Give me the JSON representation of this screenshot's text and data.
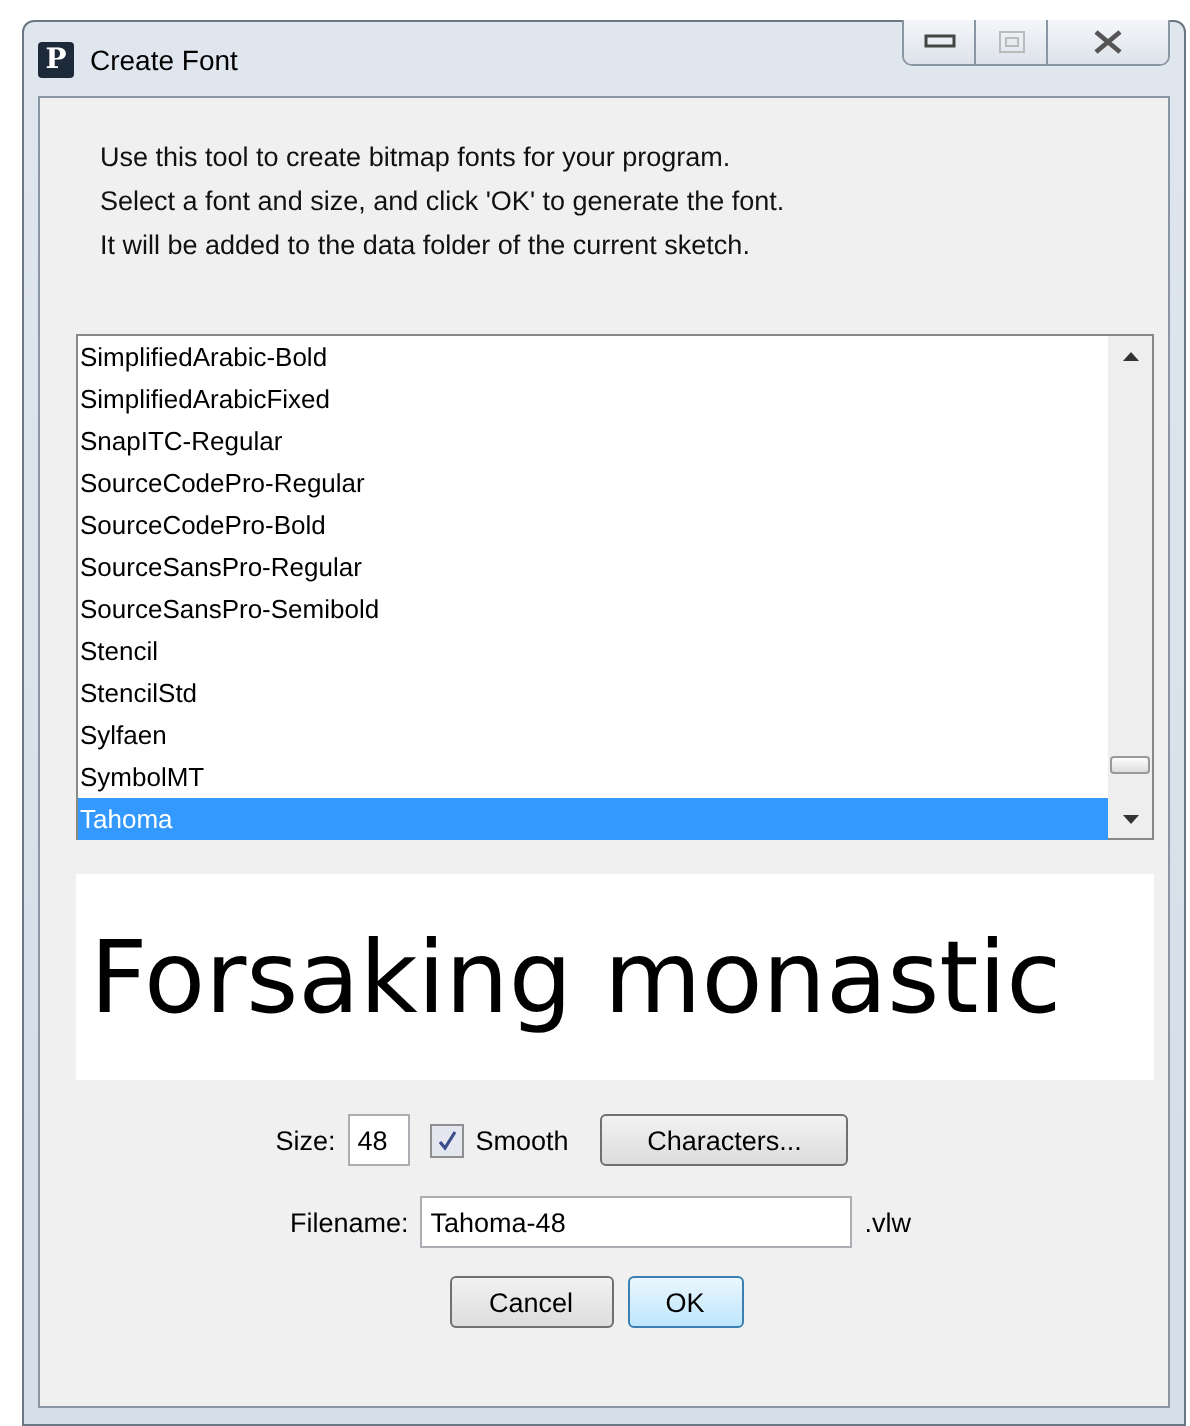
{
  "window": {
    "logo_letter": "P",
    "title": "Create Font"
  },
  "intro": [
    "Use this tool to create bitmap fonts for your program.",
    "Select a font and size, and click 'OK' to generate the font.",
    "It will be added to the data folder of the current sketch."
  ],
  "fonts": [
    {
      "name": "SimplifiedArabic-Bold",
      "selected": false
    },
    {
      "name": "SimplifiedArabicFixed",
      "selected": false
    },
    {
      "name": "SnapITC-Regular",
      "selected": false
    },
    {
      "name": "SourceCodePro-Regular",
      "selected": false
    },
    {
      "name": "SourceCodePro-Bold",
      "selected": false
    },
    {
      "name": "SourceSansPro-Regular",
      "selected": false
    },
    {
      "name": "SourceSansPro-Semibold",
      "selected": false
    },
    {
      "name": "Stencil",
      "selected": false
    },
    {
      "name": "StencilStd",
      "selected": false
    },
    {
      "name": "Sylfaen",
      "selected": false
    },
    {
      "name": "SymbolMT",
      "selected": false
    },
    {
      "name": "Tahoma",
      "selected": true
    }
  ],
  "preview": "Forsaking monastic",
  "size": {
    "label": "Size:",
    "value": "48"
  },
  "smooth": {
    "label": "Smooth",
    "checked": true
  },
  "characters_button": "Characters...",
  "filename": {
    "label": "Filename:",
    "value": "Tahoma-48",
    "extension": ".vlw"
  },
  "buttons": [
    {
      "label": "Cancel",
      "default": false
    },
    {
      "label": "OK",
      "default": true
    }
  ]
}
